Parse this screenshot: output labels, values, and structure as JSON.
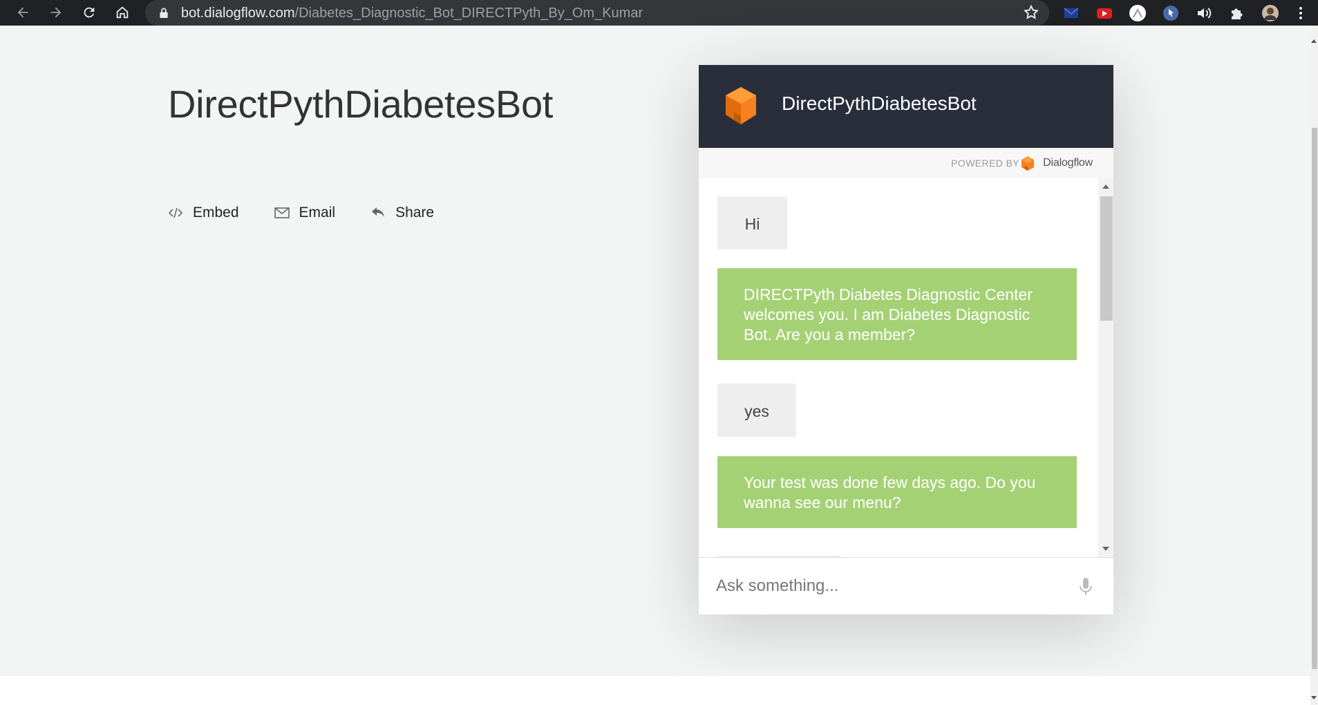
{
  "browser": {
    "url_host": "bot.dialogflow.com",
    "url_path": "/Diabetes_Diagnostic_Bot_DIRECTPyth_By_Om_Kumar"
  },
  "page": {
    "title": "DirectPythDiabetesBot",
    "actions": [
      {
        "label": "Embed",
        "icon": "code-icon"
      },
      {
        "label": "Email",
        "icon": "envelope-icon"
      },
      {
        "label": "Share",
        "icon": "reply-arrow-icon"
      }
    ]
  },
  "chat": {
    "bot_name": "DirectPythDiabetesBot",
    "powered_by": "POWERED BY",
    "brand": "Dialogflow",
    "messages": [
      {
        "from": "user",
        "text": "Hi"
      },
      {
        "from": "bot",
        "text": "DIRECTPyth Diabetes Diagnostic Center welcomes you. I am Diabetes Diagnostic Bot. Are you a member?"
      },
      {
        "from": "user",
        "text": "yes"
      },
      {
        "from": "bot",
        "text": "Your test was done few days ago. Do you wanna see our menu?"
      }
    ],
    "input_placeholder": "Ask something...",
    "colors": {
      "header_bg": "#2a2e3b",
      "bot_bubble": "#a5d175",
      "user_bubble": "#eeeeee",
      "logo_orange": "#f5821f"
    }
  }
}
